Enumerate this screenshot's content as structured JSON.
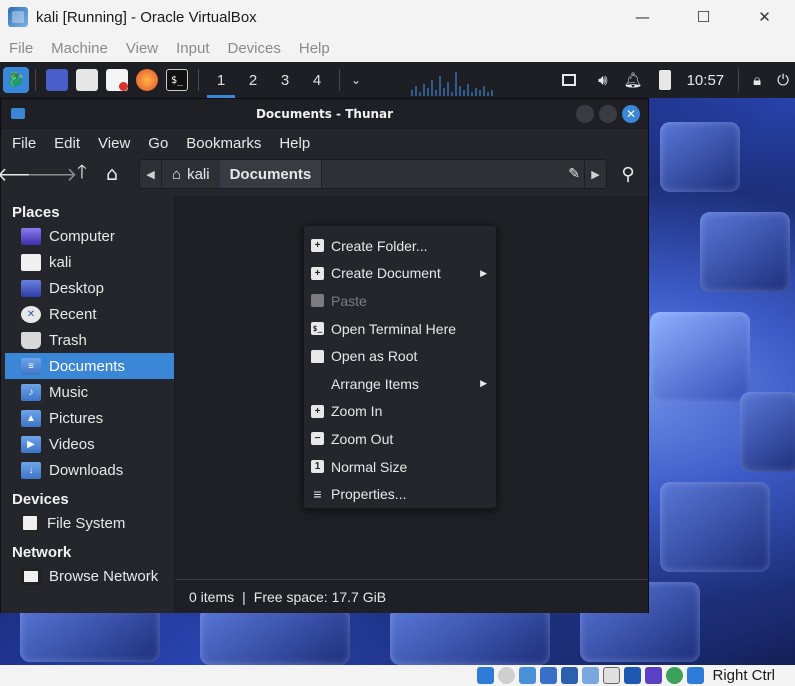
{
  "host": {
    "title": "kali [Running] - Oracle VirtualBox",
    "controls": {
      "minimize": "—",
      "maximize": "☐",
      "close": "✕"
    },
    "menu": [
      "File",
      "Machine",
      "View",
      "Input",
      "Devices",
      "Help"
    ],
    "status": {
      "host_key": "Right Ctrl"
    }
  },
  "panel": {
    "workspaces": [
      "1",
      "2",
      "3",
      "4"
    ],
    "active_workspace": "1",
    "clock": "10:57",
    "icons": [
      "kali-dragon-icon",
      "desktop-icon",
      "file-manager-icon",
      "text-editor-icon",
      "firefox-icon",
      "terminal-icon"
    ]
  },
  "thunar": {
    "title": "Documents - Thunar",
    "menu": [
      "File",
      "Edit",
      "View",
      "Go",
      "Bookmarks",
      "Help"
    ],
    "path": {
      "home": "kali",
      "current": "Documents"
    },
    "sidebar": {
      "places_label": "Places",
      "places": [
        {
          "label": "Computer",
          "icon": "computer-icon"
        },
        {
          "label": "kali",
          "icon": "home-folder-icon"
        },
        {
          "label": "Desktop",
          "icon": "desktop-folder-icon"
        },
        {
          "label": "Recent",
          "icon": "recent-icon"
        },
        {
          "label": "Trash",
          "icon": "trash-icon"
        },
        {
          "label": "Documents",
          "icon": "documents-folder-icon"
        },
        {
          "label": "Music",
          "icon": "music-folder-icon"
        },
        {
          "label": "Pictures",
          "icon": "pictures-folder-icon"
        },
        {
          "label": "Videos",
          "icon": "videos-folder-icon"
        },
        {
          "label": "Downloads",
          "icon": "downloads-folder-icon"
        }
      ],
      "devices_label": "Devices",
      "devices": [
        {
          "label": "File System",
          "icon": "drive-icon"
        }
      ],
      "network_label": "Network",
      "network": [
        {
          "label": "Browse Network",
          "icon": "network-icon"
        }
      ]
    },
    "status": {
      "items": "0 items",
      "separator": "|",
      "free": "Free space: 17.7 GiB"
    }
  },
  "context_menu": {
    "items": [
      {
        "label": "Create Folder...",
        "icon": "plus-icon"
      },
      {
        "label": "Create Document",
        "icon": "plus-icon",
        "submenu": true
      },
      {
        "label": "Paste",
        "icon": "clipboard-icon",
        "disabled": true
      },
      {
        "label": "Open Terminal Here",
        "icon": "terminal-icon"
      },
      {
        "label": "Open as Root",
        "icon": "folder-icon"
      },
      {
        "label": "Arrange Items",
        "icon": "",
        "submenu": true
      },
      {
        "label": "Zoom In",
        "icon": "plus-icon"
      },
      {
        "label": "Zoom Out",
        "icon": "minus-icon"
      },
      {
        "label": "Normal Size",
        "icon": "one-icon"
      },
      {
        "label": "Properties...",
        "icon": "list-icon"
      }
    ]
  },
  "colors": {
    "accent": "#3a86d7",
    "window_bg": "#25262b",
    "content_bg": "#1f2025",
    "panel_bg": "#1e1f24"
  }
}
